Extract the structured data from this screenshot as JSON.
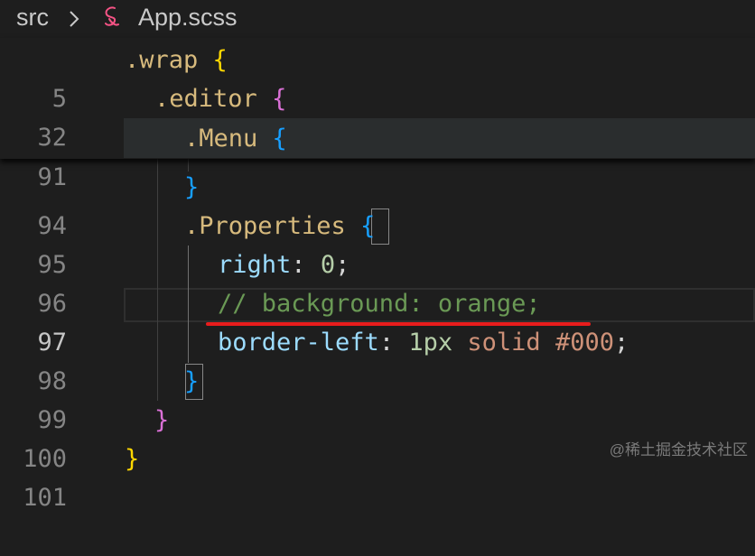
{
  "breadcrumb": {
    "folder": "src",
    "file": "App.scss",
    "separator_icon": "chevron-right-icon",
    "file_icon": "sass-icon"
  },
  "sticky_lines": [
    {
      "number": "5",
      "selector": ".wrap",
      "brace": "{"
    },
    {
      "number": "32",
      "selector": ".editor",
      "brace": "{"
    },
    {
      "number": "91",
      "selector": ".Menu",
      "brace": "{"
    }
  ],
  "lines": [
    {
      "number": "94",
      "brace": "}"
    },
    {
      "number": "95",
      "selector": ".Properties",
      "brace": "{"
    },
    {
      "number": "96",
      "prop": "right",
      "colon": ":",
      "value": "0",
      "semi": ";"
    },
    {
      "number": "97",
      "comment": "// background: orange;"
    },
    {
      "number": "98",
      "prop": "border-left",
      "colon": ":",
      "value_num": "1px",
      "value_kw": "solid",
      "value_hex": "#000",
      "semi": ";"
    },
    {
      "number": "99",
      "brace": "}"
    },
    {
      "number": "100",
      "brace": "}"
    },
    {
      "number": "101",
      "brace": "}"
    }
  ],
  "active_line": "97",
  "colors": {
    "background": "#1e1e1e",
    "selector": "#d7ba7d",
    "property": "#9cdcfe",
    "number": "#b5cea8",
    "string": "#ce9178",
    "comment": "#6a9955",
    "bracket_level1": "#ffd700",
    "bracket_level2": "#da70d6",
    "bracket_level3": "#179fff",
    "annotation_underline": "#e81c1c"
  },
  "watermark": "@稀土掘金技术社区"
}
